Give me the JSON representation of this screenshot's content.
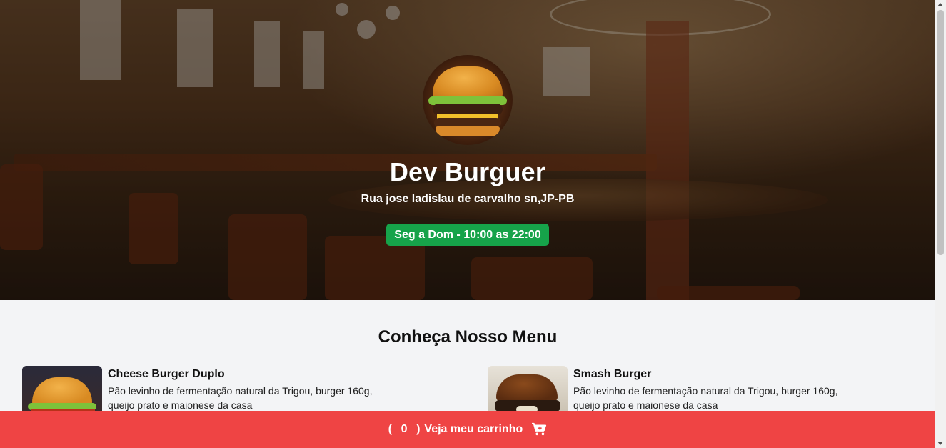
{
  "header": {
    "restaurant_name": "Dev Burguer",
    "address": "Rua jose ladislau de carvalho sn,JP-PB",
    "hours": "Seg a Dom - 10:00 as 22:00",
    "hours_color": "#16a34a"
  },
  "menu": {
    "title": "Conheça Nosso Menu",
    "items": [
      {
        "name": "Cheese Burger Duplo",
        "description": "Pão levinho de fermentação natural da Trigou, burger 160g, queijo prato e maionese da casa"
      },
      {
        "name": "Smash Burger",
        "description": "Pão levinho de fermentação natural da Trigou, burger 160g, queijo prato e maionese da casa"
      }
    ]
  },
  "cart": {
    "open_paren": "(",
    "count": "0",
    "close_paren": ")",
    "label": "Veja meu carrinho",
    "icon": "cart-plus-icon",
    "color": "#ef4444"
  }
}
